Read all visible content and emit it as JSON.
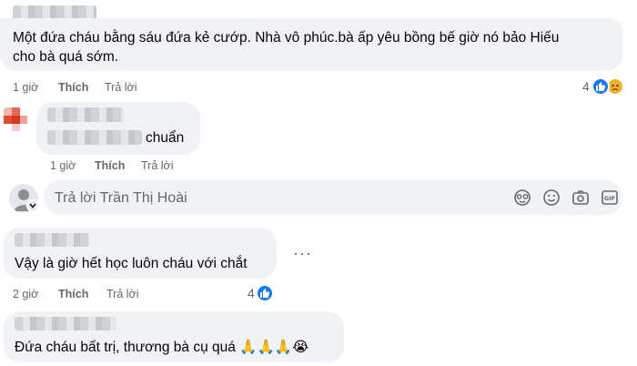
{
  "comments": [
    {
      "text_line1": "Một đứa cháu bằng sáu đứa kẻ cướp. Nhà vô phúc.bà ấp yêu bồng bế giờ nó bảo Hiếu",
      "text_line2": "cho bà quá sớm.",
      "time": "1 giờ",
      "like_label": "Thích",
      "reply_label": "Trả lời",
      "reaction_count": "4",
      "reactions": [
        "like-icon",
        "sad-icon"
      ]
    },
    {
      "text": "chuẩn",
      "time": "1 giờ",
      "like_label": "Thích",
      "reply_label": "Trả lời"
    },
    {
      "text": "Vậy là giờ hết học luôn cháu với chắt",
      "time": "2 giờ",
      "like_label": "Thích",
      "reply_label": "Trả lời",
      "reaction_count": "4",
      "reactions": [
        "like-icon"
      ]
    },
    {
      "text": "Đứa cháu bất trị, thương bà cụ quá 🙏🙏🙏😭"
    }
  ],
  "reply_box": {
    "placeholder": "Trả lời Trần Thị Hoài",
    "tools": [
      "sticker-face-icon",
      "emoji-icon",
      "camera-icon",
      "avatar-sticker-icon",
      "gif-icon",
      "sticker-icon"
    ]
  },
  "colors": {
    "bubble": "#f0f2f5",
    "secondary_text": "#65676b",
    "like_blue": "#1877f2",
    "sad_yellow": "#f7b125"
  }
}
